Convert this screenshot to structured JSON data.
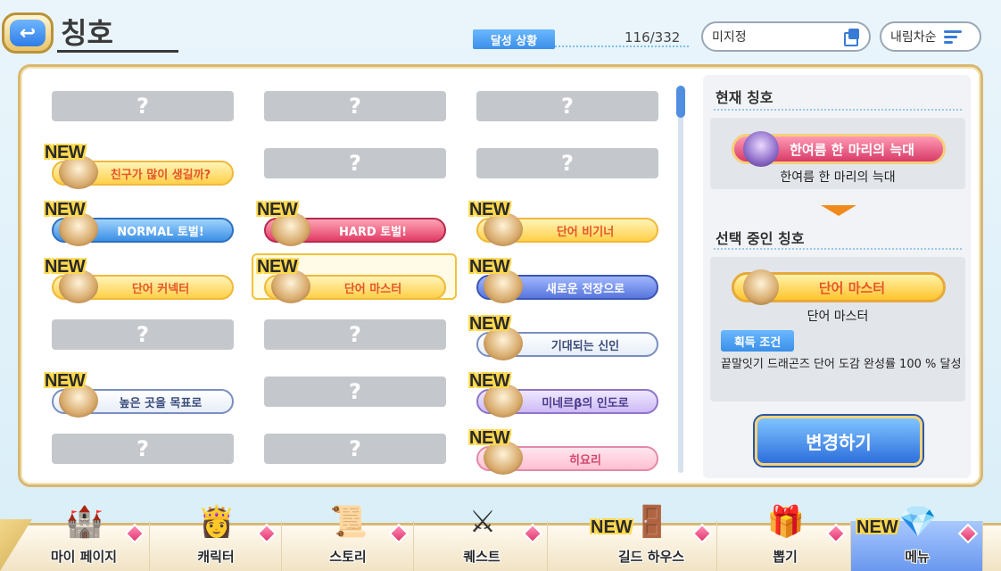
{
  "header": {
    "back_icon": "back-arrow-icon",
    "title": "칭호",
    "achievement_label": "달성 상황",
    "achievement_count": "116/332",
    "filter_label": "미지정",
    "sort_label": "내림차순"
  },
  "titles": {
    "locked_glyph": "?",
    "new_label": "NEW",
    "cells": [
      {
        "col": 0,
        "row": 0,
        "locked": true
      },
      {
        "col": 1,
        "row": 0,
        "locked": true
      },
      {
        "col": 2,
        "row": 0,
        "locked": true
      },
      {
        "col": 0,
        "row": 1,
        "locked": false,
        "new": true,
        "text": "친구가 많이 생길까?",
        "style": "yellow"
      },
      {
        "col": 1,
        "row": 1,
        "locked": true
      },
      {
        "col": 2,
        "row": 1,
        "locked": true
      },
      {
        "col": 0,
        "row": 2,
        "locked": false,
        "new": true,
        "text": "NORMAL 토벌!",
        "style": "blue"
      },
      {
        "col": 1,
        "row": 2,
        "locked": false,
        "new": true,
        "text": "HARD 토벌!",
        "style": "red"
      },
      {
        "col": 2,
        "row": 2,
        "locked": false,
        "new": true,
        "text": "단어 비기너",
        "style": "yellow"
      },
      {
        "col": 0,
        "row": 3,
        "locked": false,
        "new": true,
        "text": "단어 커넥터",
        "style": "yellow"
      },
      {
        "col": 1,
        "row": 3,
        "locked": false,
        "new": true,
        "text": "단어 마스터",
        "style": "yellow",
        "selected": true
      },
      {
        "col": 2,
        "row": 3,
        "locked": false,
        "new": true,
        "text": "새로운 전장으로",
        "style": "royal"
      },
      {
        "col": 0,
        "row": 4,
        "locked": true
      },
      {
        "col": 1,
        "row": 4,
        "locked": true
      },
      {
        "col": 2,
        "row": 4,
        "locked": false,
        "new": true,
        "text": "기대되는 신인",
        "style": "light"
      },
      {
        "col": 0,
        "row": 5,
        "locked": false,
        "new": true,
        "text": "높은 곳을 목표로",
        "style": "light"
      },
      {
        "col": 1,
        "row": 5,
        "locked": true
      },
      {
        "col": 2,
        "row": 5,
        "locked": false,
        "new": true,
        "text": "미네르β의 인도로",
        "style": "lav"
      },
      {
        "col": 0,
        "row": 6,
        "locked": true
      },
      {
        "col": 1,
        "row": 6,
        "locked": true
      },
      {
        "col": 2,
        "row": 6,
        "locked": false,
        "new": true,
        "text": "히요리",
        "style": "pink"
      }
    ]
  },
  "current": {
    "heading": "현재 칭호",
    "badge_text": "한여름 한 마리의 늑대",
    "name": "한여름 한 마리의 늑대"
  },
  "selected": {
    "heading": "선택 중인 칭호",
    "badge_text": "단어 마스터",
    "name": "단어 마스터",
    "condition_label": "획득 조건",
    "condition_text": "끝말잇기 드래곤즈 단어 도감 완성률 100 % 달성"
  },
  "change_button": "변경하기",
  "nav": {
    "items": [
      {
        "label": "마이 페이지",
        "icon": "castle-icon",
        "new": false,
        "active": false
      },
      {
        "label": "캐릭터",
        "icon": "character-icon",
        "new": false,
        "active": false
      },
      {
        "label": "스토리",
        "icon": "scroll-icon",
        "new": false,
        "active": false
      },
      {
        "label": "퀘스트",
        "icon": "swords-icon",
        "new": false,
        "active": false
      },
      {
        "label": "길드 하우스",
        "icon": "guild-door-icon",
        "new": true,
        "active": false
      },
      {
        "label": "뽑기",
        "icon": "gacha-icon",
        "new": false,
        "active": false
      },
      {
        "label": "메뉴",
        "icon": "crystal-icon",
        "new": true,
        "active": true
      }
    ],
    "new_label": "NEW"
  },
  "colors": {
    "accent_blue": "#3a8fe8",
    "frame_gold": "#d8b872",
    "new_yellow": "#ffd84a"
  }
}
